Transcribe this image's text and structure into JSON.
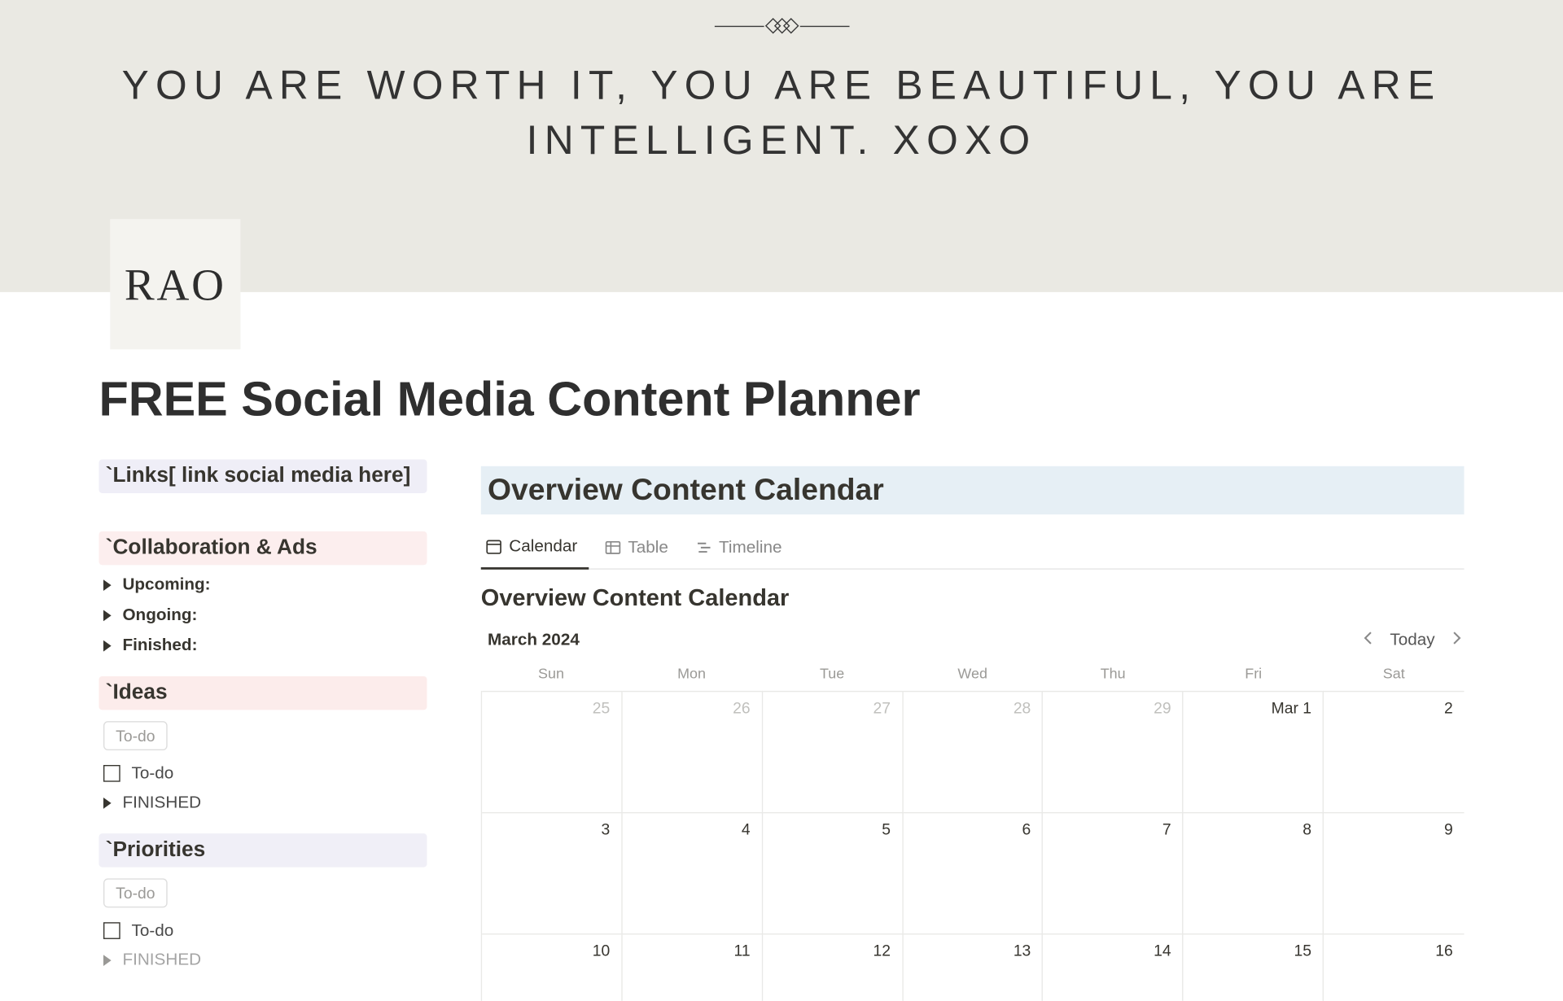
{
  "hero": {
    "quote": "YOU ARE WORTH IT, YOU ARE BEAUTIFUL, YOU ARE INTELLIGENT. XOXO",
    "logo": "RAO"
  },
  "page_title": "FREE Social Media Content Planner",
  "sidebar": {
    "links_heading": "`Links[ link social media here]",
    "collab_heading": "`Collaboration & Ads",
    "collab_items": [
      "Upcoming:",
      "Ongoing:",
      "Finished:"
    ],
    "ideas_heading": "`Ideas",
    "todo_pill": "To-do",
    "todo_item": "To-do",
    "finished_toggle": "FINISHED",
    "priorities_heading": "`Priorities",
    "priorities_todo_pill": "To-do",
    "priorities_todo_item": "To-do",
    "priorities_finished": "FINISHED"
  },
  "main": {
    "overview_heading": "Overview Content Calendar",
    "tabs": [
      {
        "label": "Calendar",
        "active": true
      },
      {
        "label": "Table",
        "active": false
      },
      {
        "label": "Timeline",
        "active": false
      }
    ],
    "db_title": "Overview Content Calendar",
    "month": "March 2024",
    "today_label": "Today",
    "day_headers": [
      "Sun",
      "Mon",
      "Tue",
      "Wed",
      "Thu",
      "Fri",
      "Sat"
    ],
    "weeks": [
      [
        {
          "n": "25",
          "faded": true
        },
        {
          "n": "26",
          "faded": true
        },
        {
          "n": "27",
          "faded": true
        },
        {
          "n": "28",
          "faded": true
        },
        {
          "n": "29",
          "faded": true
        },
        {
          "n": "Mar 1",
          "faded": false
        },
        {
          "n": "2",
          "faded": false
        }
      ],
      [
        {
          "n": "3"
        },
        {
          "n": "4"
        },
        {
          "n": "5"
        },
        {
          "n": "6"
        },
        {
          "n": "7"
        },
        {
          "n": "8"
        },
        {
          "n": "9"
        }
      ],
      [
        {
          "n": "10"
        },
        {
          "n": "11"
        },
        {
          "n": "12"
        },
        {
          "n": "13"
        },
        {
          "n": "14"
        },
        {
          "n": "15"
        },
        {
          "n": "16"
        }
      ]
    ]
  }
}
